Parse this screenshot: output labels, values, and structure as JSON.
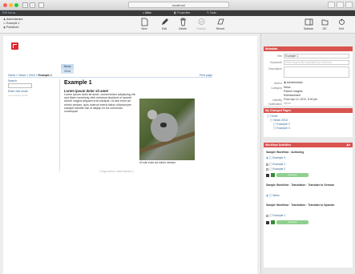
{
  "browser": {
    "url": "localhost",
    "nav_back": "‹",
    "nav_forward": "›"
  },
  "toolbar": {
    "edit_bar_label": "Edit bar ▸▸",
    "tabs": [
      {
        "label": "Main",
        "icon": "home-icon"
      },
      {
        "label": "Properties",
        "icon": "properties-icon"
      },
      {
        "label": "Tools",
        "icon": "wrench-icon"
      }
    ],
    "context": {
      "user": "Administrator",
      "item": "Example 1",
      "state": "Published"
    },
    "actions": [
      {
        "label": "New",
        "icon": "new-document-icon",
        "enabled": true
      },
      {
        "label": "Edit",
        "icon": "pencil-icon",
        "enabled": true
      },
      {
        "label": "Delete",
        "icon": "trash-icon",
        "enabled": true
      },
      {
        "label": "Publish",
        "icon": "publish-icon",
        "enabled": false
      },
      {
        "label": "Revert",
        "icon": "revert-icon",
        "enabled": true
      }
    ],
    "right_actions": [
      {
        "label": "Sidebar",
        "icon": "sidebar-icon"
      },
      {
        "label": "OE",
        "icon": "folder-icon"
      },
      {
        "label": "Exit",
        "icon": "exit-icon"
      }
    ]
  },
  "site": {
    "nav_tabs": [
      "News",
      "2016"
    ],
    "breadcrumb_prefix": "Home » News » 2016 » ",
    "breadcrumb_current": "Example 1",
    "print_link": "Print page",
    "search_label": "Search",
    "login_link": "Enter edit mode",
    "accessibility_link": "Accessibility-Mode"
  },
  "content": {
    "title": "Example 1",
    "subtitle": "Lorem ipsum dolor sit amet",
    "body": "Lorem ipsum dolor sit amet, consectetuer adipiscing elit, sed diam nonummy nibh euismod tincidunt ut laoreet dolore magna aliquam erat volutpat. Ut wisi enim ad minim veniam, quis nostrud exerci tation ullamcorper suscipit lobortis nisl ut aliquip ex ea commodo consequat.",
    "image_caption": "Ut wisi enim ad minim veniam.",
    "page_author": "[ Page author: Administrator ]"
  },
  "sidebar": {
    "metadata_title": "Metadata",
    "fields": [
      {
        "label": "Title",
        "value": "Example 1",
        "type": "input"
      },
      {
        "label": "Keywords",
        "value": "Enter keywords separated by commas",
        "type": "placeholder"
      },
      {
        "label": "Description",
        "value": "",
        "type": "textarea"
      },
      {
        "label": "Author",
        "value": "Administrator",
        "type": "text"
      },
      {
        "label": "Category",
        "value": "News",
        "type": "text"
      },
      {
        "label": "",
        "value": "Partner Insights",
        "type": "text"
      },
      {
        "label": "",
        "value": "Entertainment",
        "type": "text"
      },
      {
        "label": "Visibility",
        "value": "From Apr 12, 2012, 5:00 pm",
        "type": "text"
      },
      {
        "label": "Notification",
        "value": "Never",
        "type": "text"
      }
    ],
    "changed_title": "My Changed Pages",
    "changed_tree": [
      "Home",
      "News",
      "2016",
      "Example 2",
      "Example 3"
    ],
    "workflow_title": "Workflow Activities",
    "workflow_authoring": "Sample Workflow  ·  Authoring",
    "workflow_items_a": [
      "Example 3",
      "Example 1",
      "Example 2"
    ],
    "approve_label": "Approve",
    "workflow_german": "Sample Workflow  ·  Translation  ·  Translate to German",
    "workflow_german_item": "News",
    "workflow_spanish": "Sample Workflow  ·  Translation  ·  Translate to Spanish",
    "workflow_spanish_item": "Example 1",
    "approve_label_2": "Approve"
  }
}
